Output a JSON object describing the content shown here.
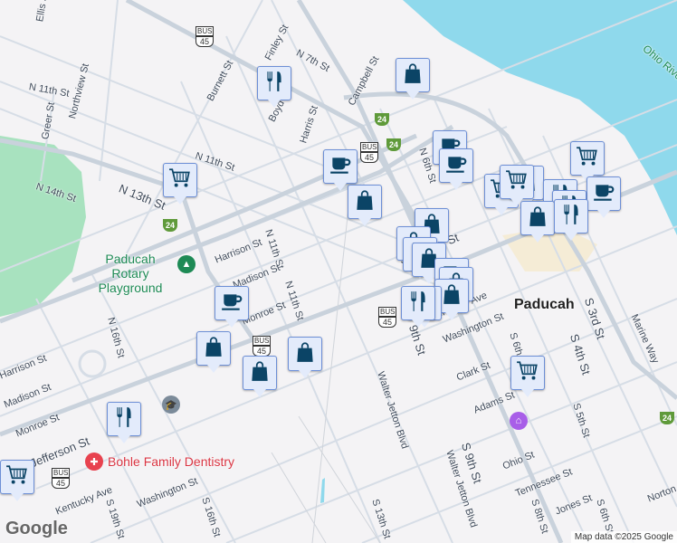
{
  "city_label": "Paducah",
  "water_label": "Ohio River",
  "pois": {
    "park": "Paducah Rotary Playground",
    "dentist": "Bohle Family Dentistry"
  },
  "streets": [
    "Ellis St",
    "Finley St",
    "N 7th St",
    "Campbell St",
    "Burnett St",
    "N 11th St",
    "Northview St",
    "Greer St",
    "Boyd St",
    "Harris St",
    "N 11th St",
    "N 14th St",
    "N 13th St",
    "N 11th St",
    "Harrison St",
    "Madison St",
    "N 11th St",
    "Monroe St",
    "N 16th St",
    "Harrison St",
    "Madison St",
    "Monroe St",
    "Jefferson St",
    "Kentucky Ave",
    "Washington St",
    "S 19th St",
    "S 16th St",
    "Jefferson St",
    "Kentucky Ave",
    "Washington St",
    "Walter Jetton Blvd",
    "9th St",
    "S 6th St",
    "Clark St",
    "Adams St",
    "S 5th St",
    "S 3rd St",
    "S 4th St",
    "Marine Way",
    "S 9th St",
    "Ohio St",
    "Tennessee St",
    "Jones St",
    "S 8th St",
    "S 6th St",
    "Norton St",
    "Walter Jetton Blvd",
    "S 13th St",
    "N 6th St"
  ],
  "shields": {
    "interstate": "24",
    "bus": "BUS",
    "us": "45"
  },
  "markers": [
    "restaurant",
    "shopping",
    "cart",
    "coffee",
    "shopping",
    "coffee",
    "coffee",
    "cart",
    "shopping",
    "cart",
    "cart",
    "restaurant",
    "coffee",
    "restaurant",
    "shopping",
    "restaurant",
    "shopping",
    "shopping",
    "restaurant",
    "shopping",
    "coffee",
    "shopping",
    "shopping",
    "shopping",
    "restaurant",
    "cart",
    "cart"
  ],
  "branding": {
    "logo": "Google",
    "attribution": "Map data ©2025 Google"
  },
  "colors": {
    "marker_fill": "#e3ebfb",
    "marker_icon": "#0b4466",
    "water": "#8fd9ec",
    "park": "#a8e2bf"
  }
}
